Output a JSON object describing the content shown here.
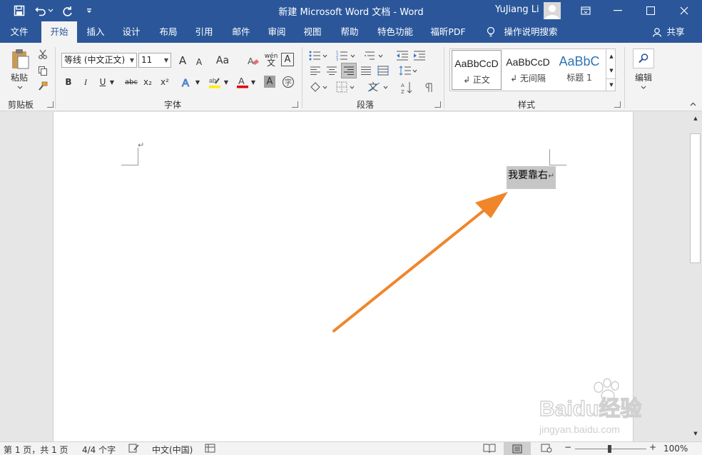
{
  "app": {
    "title": "新建 Microsoft Word 文档  -  Word",
    "user": "YuJiang Li"
  },
  "menu_tabs": [
    {
      "label": "文件"
    },
    {
      "label": "开始"
    },
    {
      "label": "插入"
    },
    {
      "label": "设计"
    },
    {
      "label": "布局"
    },
    {
      "label": "引用"
    },
    {
      "label": "邮件"
    },
    {
      "label": "审阅"
    },
    {
      "label": "视图"
    },
    {
      "label": "帮助"
    },
    {
      "label": "特色功能"
    },
    {
      "label": "福昕PDF"
    },
    {
      "label": "操作说明搜索"
    },
    {
      "label": "共享"
    }
  ],
  "ribbon": {
    "clipboard": {
      "paste_label": "粘贴",
      "group_label": "剪贴板"
    },
    "font": {
      "font_name": "等线 (中文正文)",
      "font_size": "11",
      "grow_label": "A",
      "shrink_label": "A",
      "case_label": "Aa",
      "phonetic_label": "wén",
      "bold": "B",
      "italic": "I",
      "underline": "U",
      "strike": "abc",
      "subscript": "x₂",
      "superscript": "x²",
      "group_label": "字体"
    },
    "paragraph": {
      "group_label": "段落"
    },
    "styles": {
      "items": [
        {
          "preview": "AaBbCcD",
          "name": "↲ 正文"
        },
        {
          "preview": "AaBbCcD",
          "name": "↲ 无间隔"
        },
        {
          "preview": "AaBbC",
          "name": "标题 1"
        }
      ],
      "group_label": "样式"
    },
    "editing": {
      "label": "编辑"
    }
  },
  "document": {
    "text": "我要靠右",
    "para_mark": "↵"
  },
  "status": {
    "page": "第 1 页，共 1 页",
    "words": "4/4 个字",
    "language": "中文(中国)",
    "zoom": "100%"
  },
  "colors": {
    "brand": "#2b579a",
    "arrow": "#f0862a",
    "highlight": "#c6c6c6"
  },
  "watermark": {
    "brand": "Baidu经验",
    "url": "jingyan.baidu.com"
  }
}
